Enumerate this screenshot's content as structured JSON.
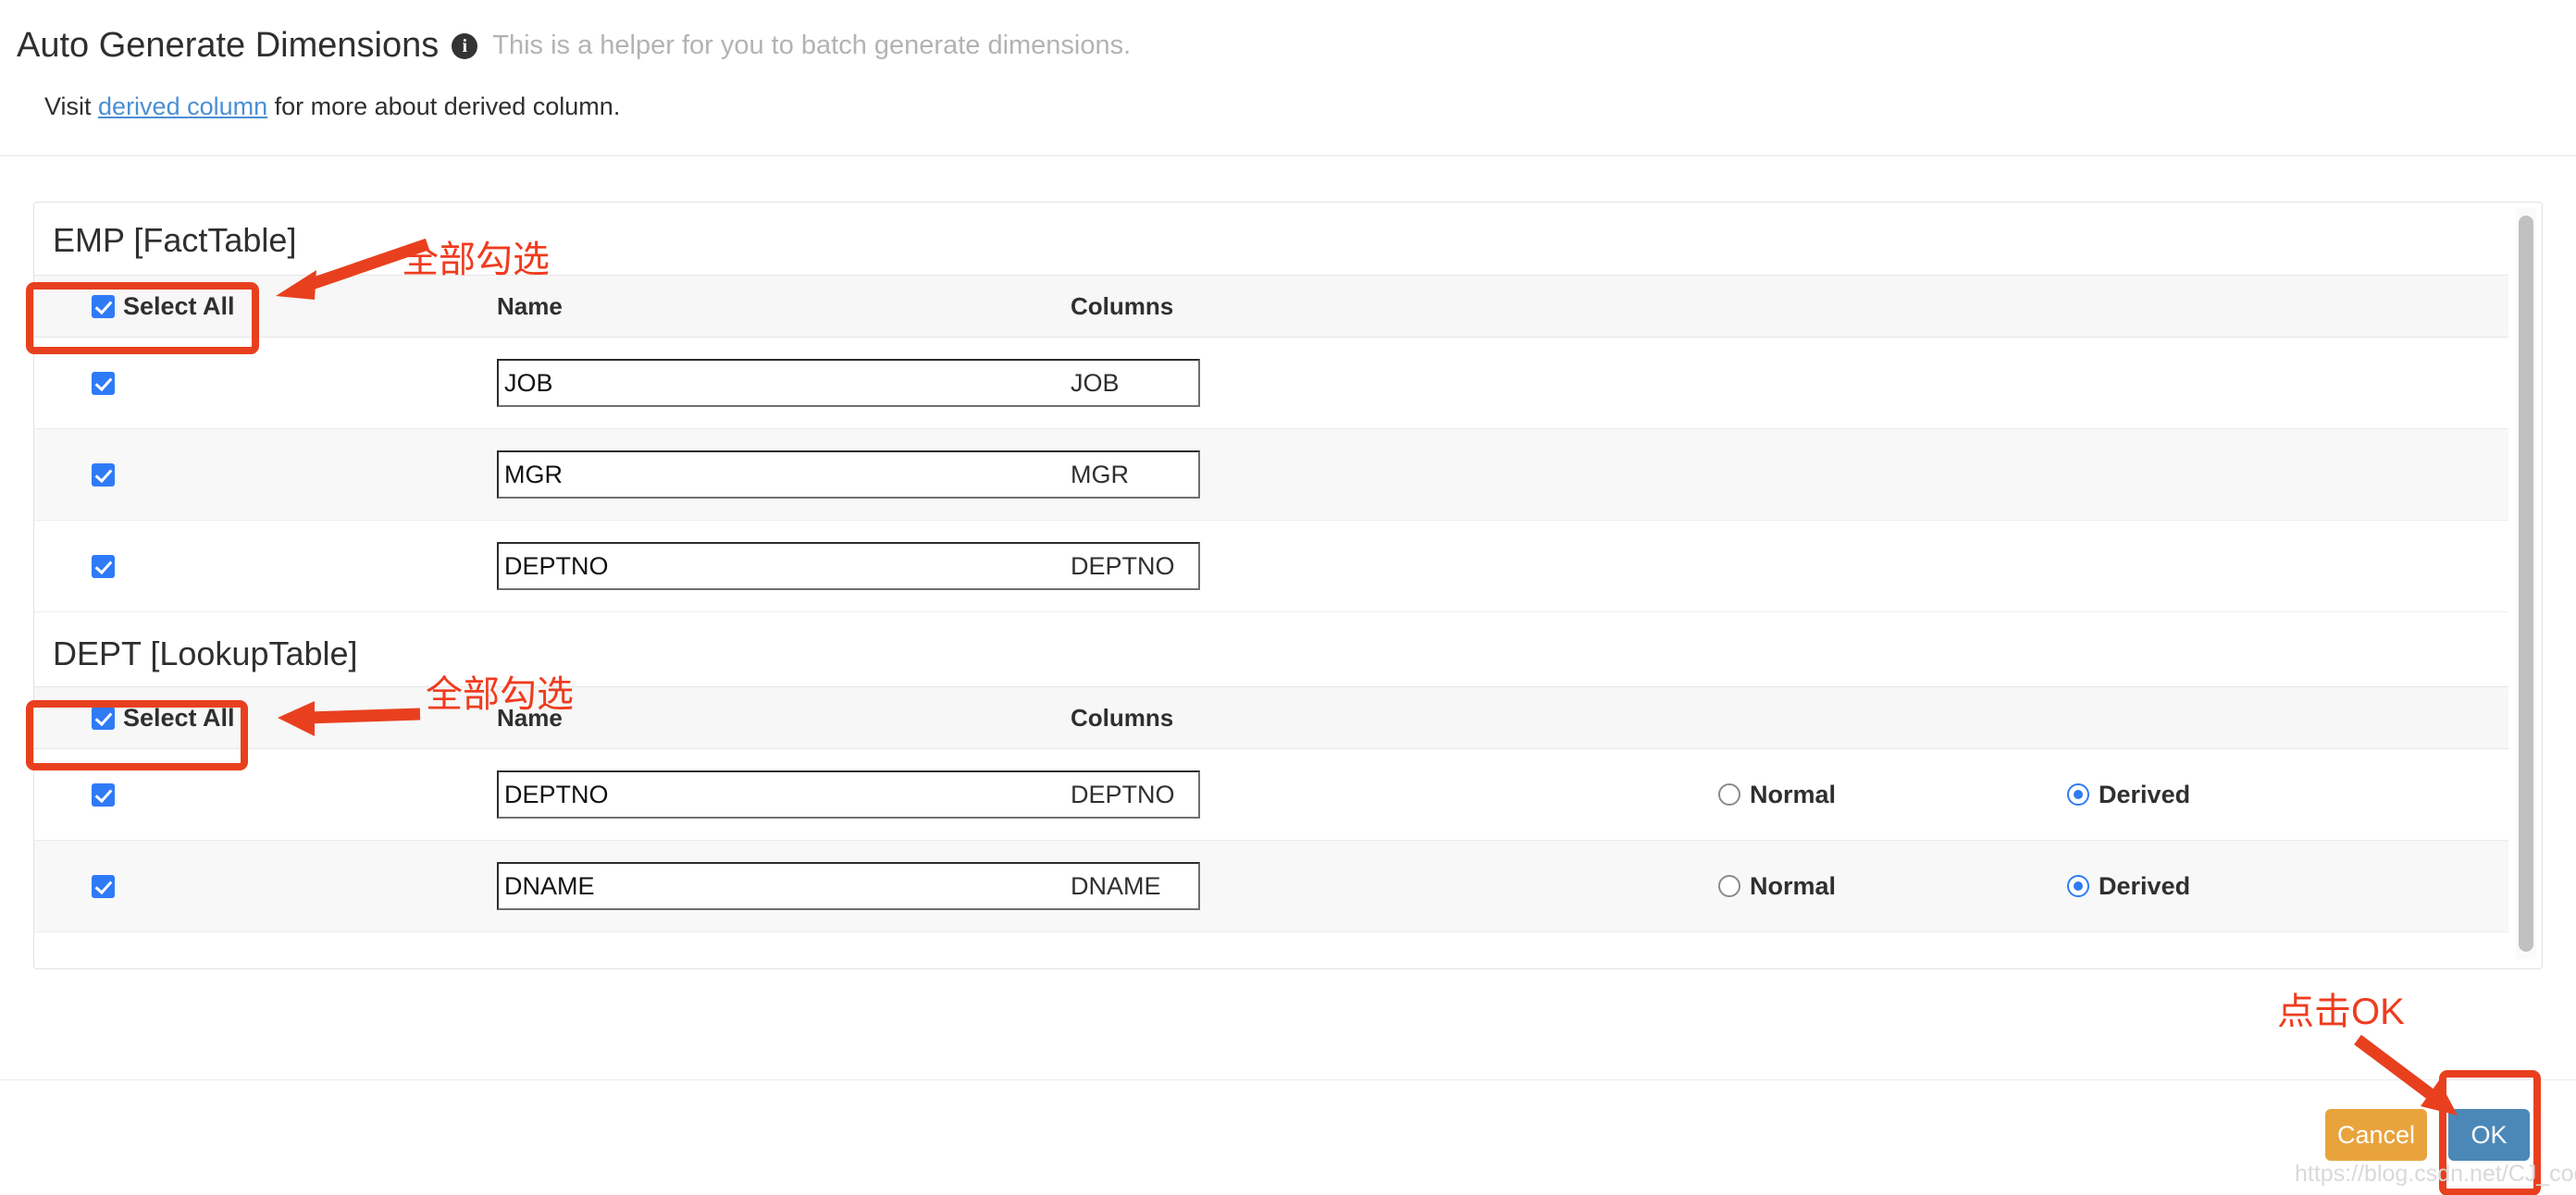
{
  "header": {
    "title": "Auto Generate Dimensions",
    "info_icon": "info-icon",
    "subtitle": "This is a helper for you to batch generate dimensions.",
    "visit_prefix": "Visit ",
    "link_text": "derived column",
    "visit_suffix": " for more about derived column."
  },
  "sections": [
    {
      "title": "EMP [FactTable]",
      "select_all_label": "Select All",
      "select_all_checked": true,
      "columns": {
        "name": "Name",
        "columns": "Columns"
      },
      "has_mode": false,
      "rows": [
        {
          "checked": true,
          "name_value": "JOB",
          "column": "JOB"
        },
        {
          "checked": true,
          "name_value": "MGR",
          "column": "MGR"
        },
        {
          "checked": true,
          "name_value": "DEPTNO",
          "column": "DEPTNO"
        }
      ]
    },
    {
      "title": "DEPT [LookupTable]",
      "select_all_label": "Select All",
      "select_all_checked": true,
      "columns": {
        "name": "Name",
        "columns": "Columns"
      },
      "has_mode": true,
      "mode_options": {
        "normal": "Normal",
        "derived": "Derived"
      },
      "rows": [
        {
          "checked": true,
          "name_value": "DEPTNO",
          "column": "DEPTNO",
          "mode": "derived"
        },
        {
          "checked": true,
          "name_value": "DNAME",
          "column": "DNAME",
          "mode": "derived"
        }
      ]
    }
  ],
  "footer": {
    "cancel_label": "Cancel",
    "ok_label": "OK"
  },
  "annotations": {
    "select_all_1": "全部勾选",
    "select_all_2": "全部勾选",
    "click_ok": "点击OK"
  },
  "watermark": "https://blog.csdn.net/CJ_codingfish",
  "colors": {
    "accent_blue": "#2f7bf6",
    "ok_button": "#4b88b8",
    "cancel_button": "#e8a33d",
    "annotation_red": "#e8401f",
    "link_blue": "#4b8fd4"
  }
}
